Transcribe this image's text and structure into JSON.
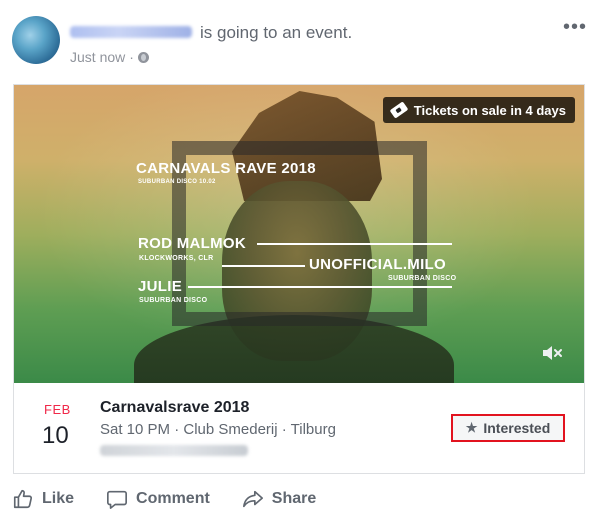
{
  "post": {
    "action_text": "is going to an event.",
    "time": "Just now",
    "separator": "·",
    "more": "•••"
  },
  "event": {
    "ticket_badge": "Tickets on sale in 4 days",
    "poster": {
      "title": "CARNAVALS RAVE 2018",
      "subtitle": "SUBURBAN DISCO 10.02",
      "lineup": [
        {
          "name": "ROD MALMOK",
          "sub": "KLOCKWORKS, CLR"
        },
        {
          "name": "UNOFFICIAL.MILO",
          "sub": "SUBURBAN DISCO"
        },
        {
          "name": "JULIE",
          "sub": "SUBURBAN DISCO"
        }
      ]
    },
    "mute_icon": "🔇",
    "month": "FEB",
    "day": "10",
    "title": "Carnavalsrave 2018",
    "meta": "Sat 10 PM · Club Smederij · Tilburg",
    "interested_label": "Interested",
    "star": "★"
  },
  "actions": {
    "like": "Like",
    "comment": "Comment",
    "share": "Share"
  },
  "colors": {
    "date_month": "#f02849",
    "interested_border": "#e2131f"
  },
  "icons": [
    "globe-icon",
    "more-icon",
    "ticket-icon",
    "mute-icon",
    "star-icon",
    "like-icon",
    "comment-icon",
    "share-icon"
  ]
}
